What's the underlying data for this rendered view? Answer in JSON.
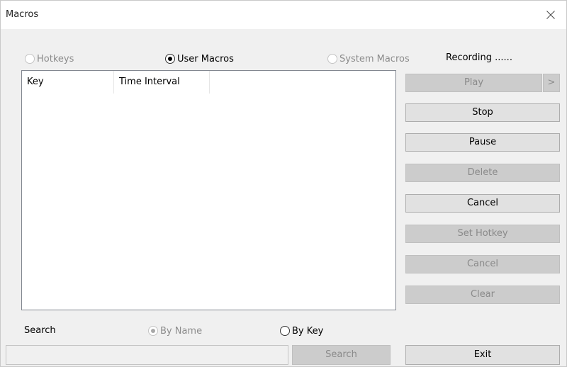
{
  "window": {
    "title": "Macros"
  },
  "mode": {
    "options": [
      {
        "label": "Hotkeys",
        "selected": false,
        "enabled": false
      },
      {
        "label": "User Macros",
        "selected": true,
        "enabled": true
      },
      {
        "label": "System Macros",
        "selected": false,
        "enabled": false
      }
    ]
  },
  "status": {
    "text": "Recording ......"
  },
  "list": {
    "columns": [
      "Key",
      "Time Interval"
    ],
    "rows": []
  },
  "buttons": {
    "play": {
      "label": "Play",
      "enabled": false
    },
    "play_more": {
      "label": ">",
      "enabled": false
    },
    "stop": {
      "label": "Stop",
      "enabled": true
    },
    "pause": {
      "label": "Pause",
      "enabled": true
    },
    "delete": {
      "label": "Delete",
      "enabled": false
    },
    "cancel": {
      "label": "Cancel",
      "enabled": true
    },
    "set_hotkey": {
      "label": "Set Hotkey",
      "enabled": false
    },
    "cancel_2": {
      "label": "Cancel",
      "enabled": false
    },
    "clear": {
      "label": "Clear",
      "enabled": false
    },
    "exit": {
      "label": "Exit",
      "enabled": true
    }
  },
  "search": {
    "label": "Search",
    "by_name": {
      "label": "By Name",
      "selected": true,
      "enabled": false
    },
    "by_key": {
      "label": "By Key",
      "selected": false,
      "enabled": true
    },
    "input_value": "",
    "button_label": "Search"
  }
}
